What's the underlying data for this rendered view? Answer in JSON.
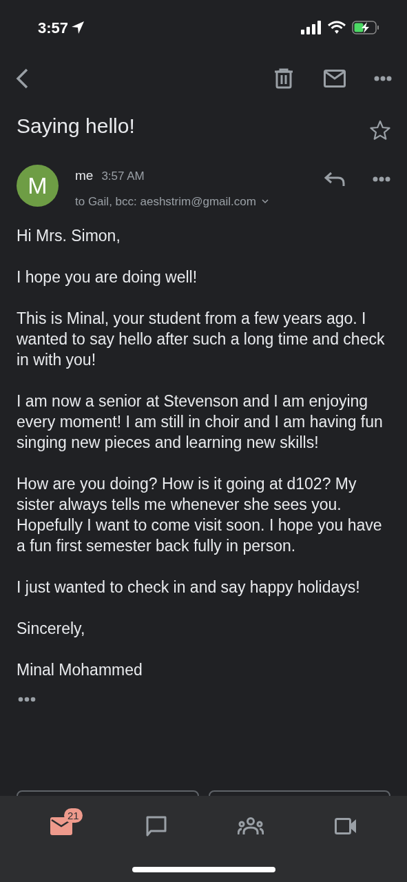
{
  "status_bar": {
    "time": "3:57"
  },
  "subject": "Saying hello!",
  "starred": false,
  "message": {
    "avatar_letter": "M",
    "sender": "me",
    "time": "3:57 AM",
    "recipients": "to Gail, bcc: aeshstrim@gmail.com",
    "paragraphs": [
      "Hi Mrs. Simon,",
      "I hope you are doing well!",
      "This is Minal, your student from a few years ago. I wanted to say hello after such a long time and check in with you!",
      "I am now a senior at Stevenson and I am enjoying every moment! I am still in choir and I am having fun singing new pieces and learning new skills!",
      "How are you doing? How is it going at d102? My sister always tells me whenever she sees you. Hopefully I want to come visit soon. I hope you have a fun first semester back fully in person.",
      "I just wanted to check in and say happy holidays!",
      "Sincerely,",
      "Minal Mohammed"
    ]
  },
  "bottom_nav": [
    {
      "kind": "mail",
      "selected": true,
      "badge": "21"
    },
    {
      "kind": "chat",
      "selected": false
    },
    {
      "kind": "spaces",
      "selected": false
    },
    {
      "kind": "meet",
      "selected": false
    }
  ]
}
